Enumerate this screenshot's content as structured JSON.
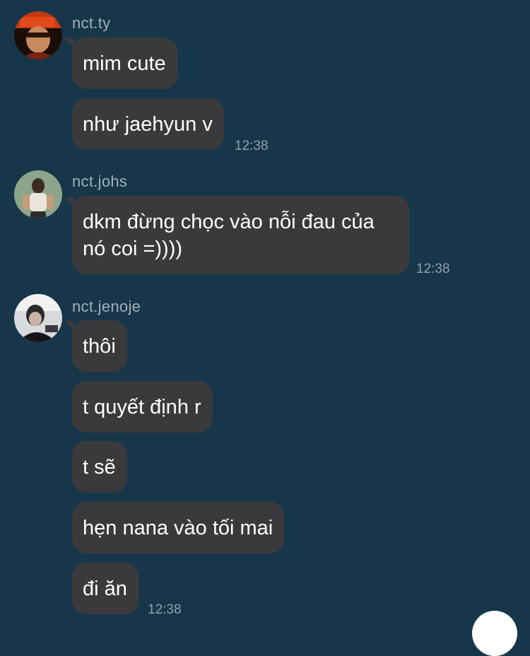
{
  "messages": [
    {
      "username": "nct.ty",
      "bubbles": [
        "mim cute",
        "như jaehyun v"
      ],
      "time": "12:38"
    },
    {
      "username": "nct.johs",
      "bubbles": [
        "dkm đừng chọc vào nỗi đau của nó coi =))))"
      ],
      "time": "12:38"
    },
    {
      "username": "nct.jenoje",
      "bubbles": [
        "thôi",
        "t quyết định r",
        "t sẽ",
        "hẹn nana vào tối mai",
        "đi ăn"
      ],
      "time": "12:38"
    }
  ],
  "colors": {
    "background": "#17364a",
    "bubble": "#3a3a3c",
    "username": "#a3b1bc",
    "timestamp": "#8fa0ad"
  }
}
